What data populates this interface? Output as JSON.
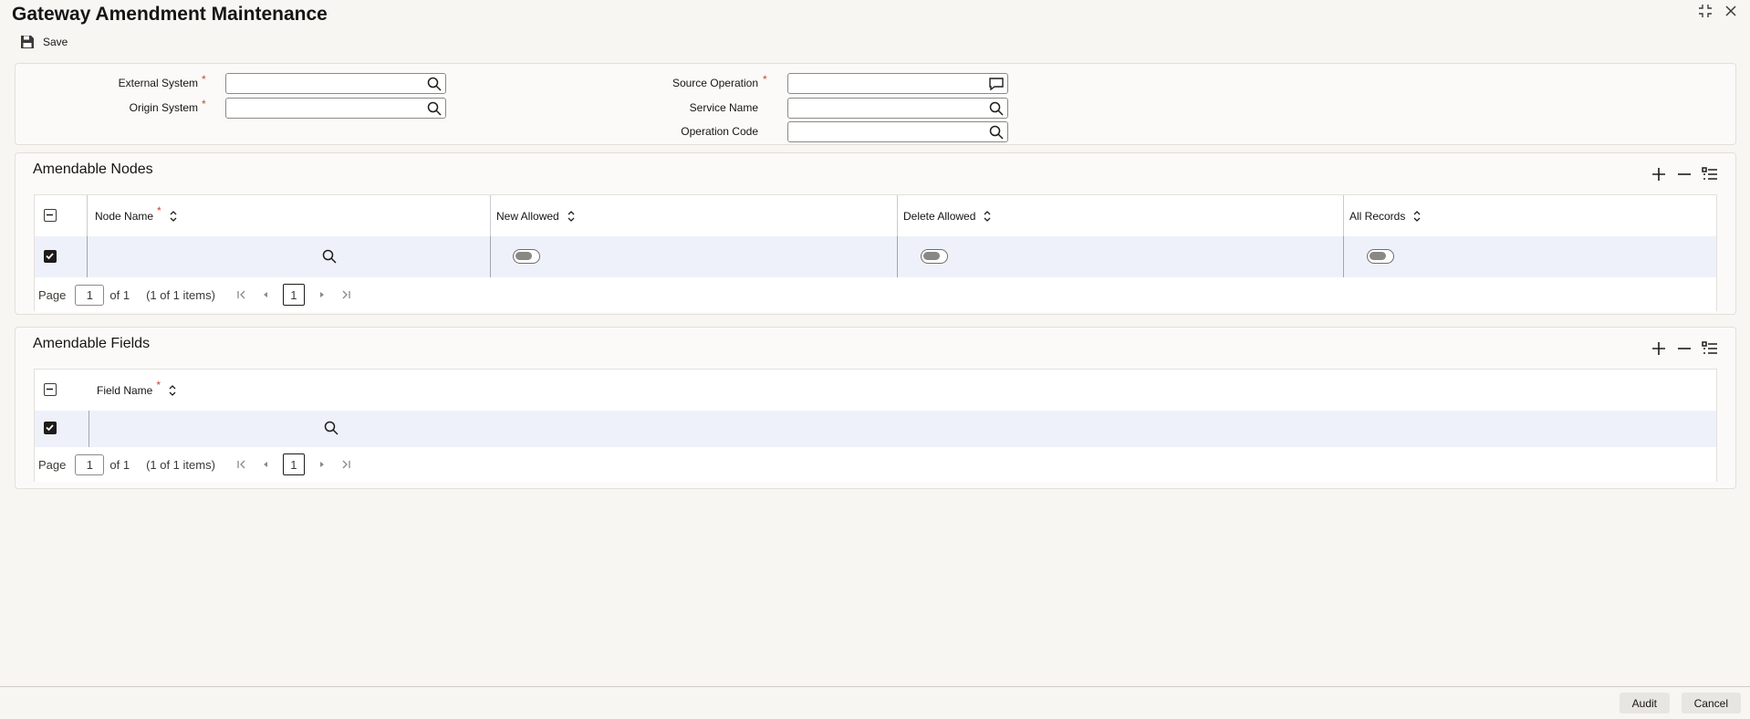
{
  "window": {
    "title": "Gateway Amendment Maintenance"
  },
  "toolbar": {
    "save_label": "Save"
  },
  "form": {
    "external_system": {
      "label": "External System",
      "value": ""
    },
    "origin_system": {
      "label": "Origin System",
      "value": ""
    },
    "source_operation": {
      "label": "Source Operation",
      "value": ""
    },
    "service_name": {
      "label": "Service Name",
      "value": ""
    },
    "operation_code": {
      "label": "Operation Code",
      "value": ""
    },
    "required_mark": "*"
  },
  "nodes": {
    "title": "Amendable Nodes",
    "columns": [
      "Node Name",
      "New Allowed",
      "Delete Allowed",
      "All Records"
    ],
    "rows": [
      {
        "node_name": "",
        "new_allowed": false,
        "delete_allowed": false,
        "all_records": false,
        "selected": true
      }
    ],
    "pager": {
      "page_label": "Page",
      "page": "1",
      "of_label": "of 1",
      "items_label": "(1 of 1 items)",
      "current": "1"
    }
  },
  "fields": {
    "title": "Amendable Fields",
    "columns": [
      "Field Name"
    ],
    "rows": [
      {
        "field_name": "",
        "selected": true
      }
    ],
    "pager": {
      "page_label": "Page",
      "page": "1",
      "of_label": "of 1",
      "items_label": "(1 of 1 items)",
      "current": "1"
    }
  },
  "footer": {
    "audit_label": "Audit",
    "cancel_label": "Cancel"
  }
}
